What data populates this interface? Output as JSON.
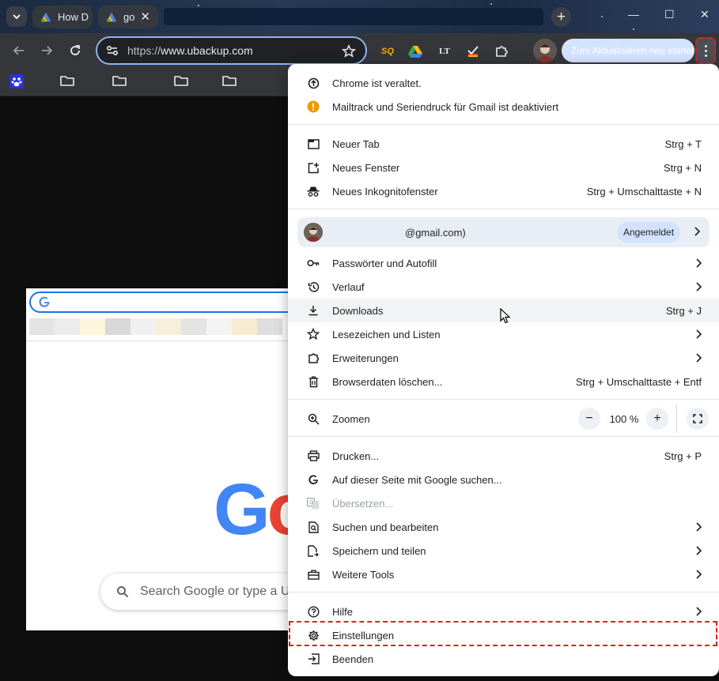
{
  "tabs": [
    {
      "label": "How D"
    },
    {
      "label": "go"
    }
  ],
  "address_bar": {
    "scheme": "https://",
    "host": "www.ubackup.com"
  },
  "toolbar": {
    "update_button": "Zum Aktualisieren neu starten"
  },
  "extensions": [
    "sq-extension-icon",
    "google-drive-icon",
    "languagetool-icon",
    "checkmark-extension-icon",
    "puzzle-icon"
  ],
  "page": {
    "search_placeholder": "Search Google or type a U",
    "logo_text_blue": "G",
    "logo_text_red": "o"
  },
  "menu": {
    "notices": [
      {
        "label": "Chrome ist veraltet."
      },
      {
        "label": "Mailtrack und Seriendruck für Gmail ist deaktiviert"
      }
    ],
    "new_tab": {
      "label": "Neuer Tab",
      "shortcut": "Strg + T"
    },
    "new_window": {
      "label": "Neues Fenster",
      "shortcut": "Strg + N"
    },
    "incognito": {
      "label": "Neues Inkognitofenster",
      "shortcut": "Strg + Umschalttaste + N"
    },
    "account": {
      "email": "@gmail.com)",
      "status": "Angemeldet"
    },
    "passwords": {
      "label": "Passwörter und Autofill"
    },
    "history": {
      "label": "Verlauf"
    },
    "downloads": {
      "label": "Downloads",
      "shortcut": "Strg + J"
    },
    "bookmarks": {
      "label": "Lesezeichen und Listen"
    },
    "extensions": {
      "label": "Erweiterungen"
    },
    "clear_data": {
      "label": "Browserdaten löschen...",
      "shortcut": "Strg + Umschalttaste + Entf"
    },
    "zoom": {
      "label": "Zoomen",
      "value": "100 %",
      "minus": "−",
      "plus": "+"
    },
    "print": {
      "label": "Drucken...",
      "shortcut": "Strg + P"
    },
    "search_page": {
      "label": "Auf dieser Seite mit Google suchen..."
    },
    "translate": {
      "label": "Übersetzen..."
    },
    "find_edit": {
      "label": "Suchen und bearbeiten"
    },
    "save_share": {
      "label": "Speichern und teilen"
    },
    "more_tools": {
      "label": "Weitere Tools"
    },
    "help": {
      "label": "Hilfe"
    },
    "settings": {
      "label": "Einstellungen"
    },
    "exit": {
      "label": "Beenden"
    }
  },
  "colors": {
    "highlight": "#e0201b",
    "accent": "#8ab4f8",
    "badge": "#d3e3fd"
  }
}
